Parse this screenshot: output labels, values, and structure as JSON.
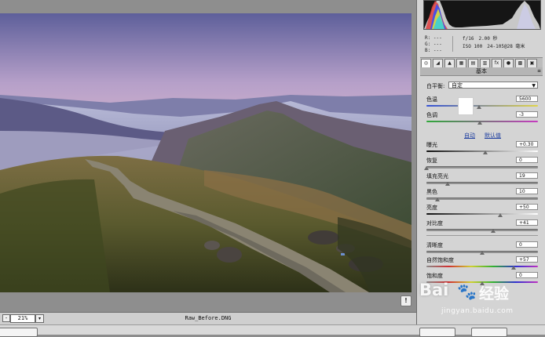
{
  "preview": {
    "zoom_minus": "-",
    "zoom_value": "21%",
    "zoom_dropdown": "▾",
    "filename": "Raw_Before.DNG",
    "warning_icon": "!"
  },
  "info": {
    "r_label": "R:",
    "r_value": "---",
    "g_label": "G:",
    "g_value": "---",
    "b_label": "B:",
    "b_value": "---",
    "aperture": "f/16",
    "shutter": "2.00 秒",
    "iso": "ISO 100",
    "focal": "24-105@28 毫米"
  },
  "panel": {
    "title": "基本",
    "tabs": [
      "◎",
      "◢",
      "▲",
      "▦",
      "▤",
      "▥",
      "fx",
      "●",
      "▩",
      "▣"
    ],
    "white_balance_label": "白平衡:",
    "white_balance_value": "自定",
    "temperature_label": "色温",
    "temperature_value": "5600",
    "tint_label": "色调",
    "tint_value": "-3",
    "auto_label": "自动",
    "default_label": "默认值",
    "exposure_label": "曝光",
    "exposure_value": "+0.30",
    "recovery_label": "恢复",
    "recovery_value": "0",
    "fill_light_label": "填充亮光",
    "fill_light_value": "19",
    "blacks_label": "黑色",
    "blacks_value": "10",
    "brightness_label": "亮度",
    "brightness_value": "+50",
    "contrast_label": "对比度",
    "contrast_value": "+41",
    "clarity_label": "清晰度",
    "clarity_value": "0",
    "vibrance_label": "自然饱和度",
    "vibrance_value": "+57",
    "saturation_label": "饱和度",
    "saturation_value": "0"
  },
  "sliders": {
    "temperature": 0.47,
    "tint": 0.48,
    "exposure": 0.53,
    "recovery": 0.0,
    "fill_light": 0.19,
    "blacks": 0.1,
    "brightness": 0.66,
    "contrast": 0.6,
    "clarity": 0.5,
    "vibrance": 0.78,
    "saturation": 0.5
  },
  "watermark": {
    "brand": "Bai",
    "paw": "🐾",
    "jingyan": "经验",
    "url": "jingyan.baidu.com"
  },
  "colors": {
    "panel_bg": "#d4d4d4",
    "link": "#1f3fa0",
    "track_temp_start": "#3552d6",
    "track_temp_end": "#e0d44a"
  }
}
